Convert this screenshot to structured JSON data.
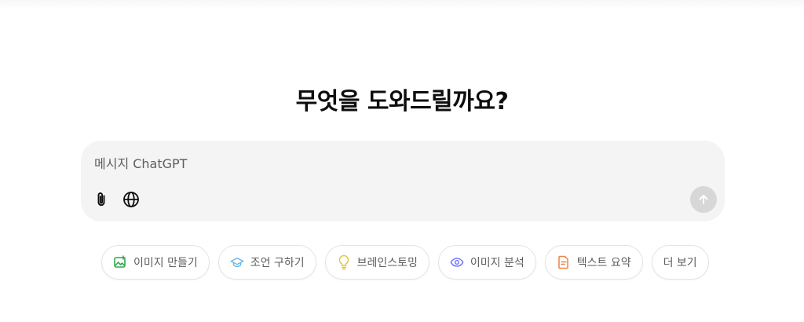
{
  "heading": "무엇을 도와드릴까요?",
  "composer": {
    "placeholder": "메시지 ChatGPT"
  },
  "chips": [
    {
      "label": "이미지 만들기",
      "icon": "image-create-icon",
      "color": "#35a64f"
    },
    {
      "label": "조언 구하기",
      "icon": "graduation-cap-icon",
      "color": "#66b5e8"
    },
    {
      "label": "브레인스토밍",
      "icon": "lightbulb-icon",
      "color": "#e2c541"
    },
    {
      "label": "이미지 분석",
      "icon": "eye-icon",
      "color": "#6c71ff"
    },
    {
      "label": "텍스트 요약",
      "icon": "document-icon",
      "color": "#ea8444"
    },
    {
      "label": "더 보기"
    }
  ],
  "colors": {
    "composer_bg": "#f4f4f4",
    "send_button_disabled": "#d7d7d7",
    "chip_text": "#5d5d5d"
  }
}
